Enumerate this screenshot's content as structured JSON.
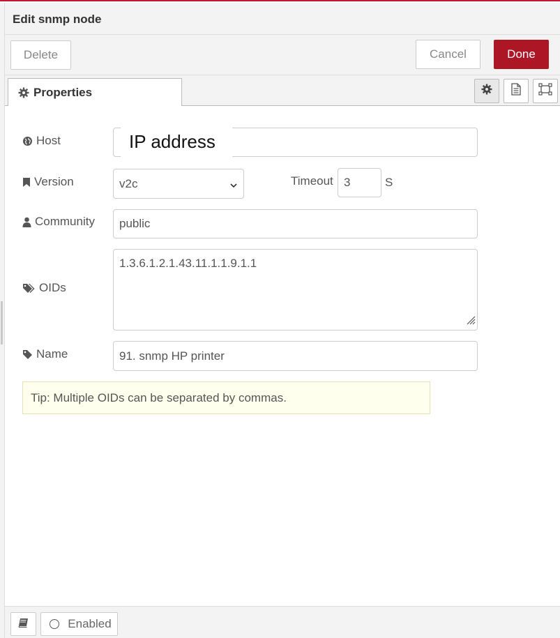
{
  "header": {
    "title": "Edit snmp node"
  },
  "toolbar": {
    "delete_label": "Delete",
    "cancel_label": "Cancel",
    "done_label": "Done"
  },
  "tabs": [
    {
      "label": "Properties",
      "icon": "gear-icon"
    }
  ],
  "tab_icons": [
    "settings-icon",
    "description-icon",
    "appearance-icon"
  ],
  "form": {
    "host": {
      "label": "Host",
      "overlay_text": "IP address"
    },
    "version": {
      "label": "Version",
      "value": "v2c"
    },
    "timeout": {
      "label": "Timeout",
      "value": "3",
      "unit": "S"
    },
    "community": {
      "label": "Community",
      "value": "public"
    },
    "oids": {
      "label": "OIDs",
      "value": "1.3.6.1.2.1.43.11.1.1.9.1.1"
    },
    "name": {
      "label": "Name",
      "value": "91. snmp HP printer"
    }
  },
  "tip": "Tip: Multiple OIDs can be separated by commas.",
  "footer": {
    "enabled_label": "Enabled"
  },
  "colors": {
    "accent": "#ad1625",
    "top_border": "#c0182b",
    "tip_bg": "#ffffee"
  }
}
